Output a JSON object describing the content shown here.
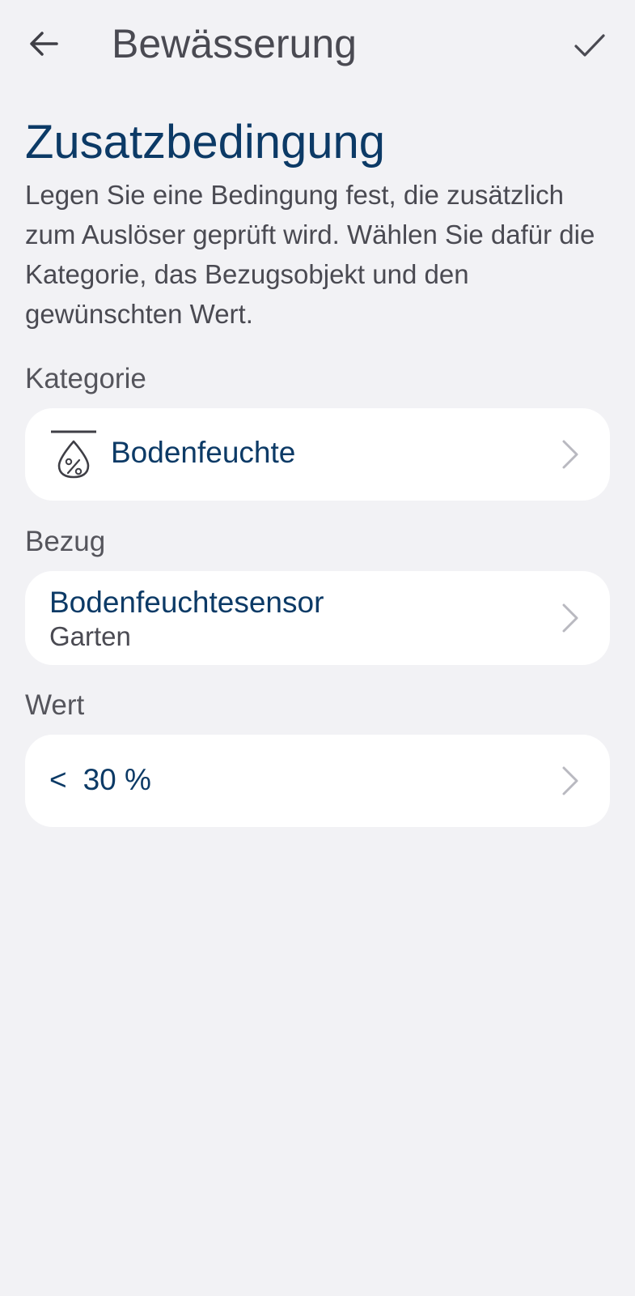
{
  "app_bar": {
    "title": "Bewässerung",
    "back_icon": "arrow-left-icon",
    "confirm_icon": "check-icon"
  },
  "section": {
    "title": "Zusatzbedingung",
    "description": "Legen Sie eine Bedingung fest, die zusätzlich zum Auslöser geprüft wird. Wählen Sie dafür die Kategorie, das Bezugsobjekt und den gewünschten Wert."
  },
  "category": {
    "label": "Kategorie",
    "value": "Bodenfeuchte",
    "icon": "soil-moisture-icon"
  },
  "reference": {
    "label": "Bezug",
    "device": "Bodenfeuchtesensor",
    "location": "Garten"
  },
  "value": {
    "label": "Wert",
    "operator": "<",
    "amount": "30 %"
  },
  "colors": {
    "background": "#f2f2f5",
    "card": "#ffffff",
    "accent": "#0c3a66",
    "text_secondary": "#4a4a52"
  }
}
